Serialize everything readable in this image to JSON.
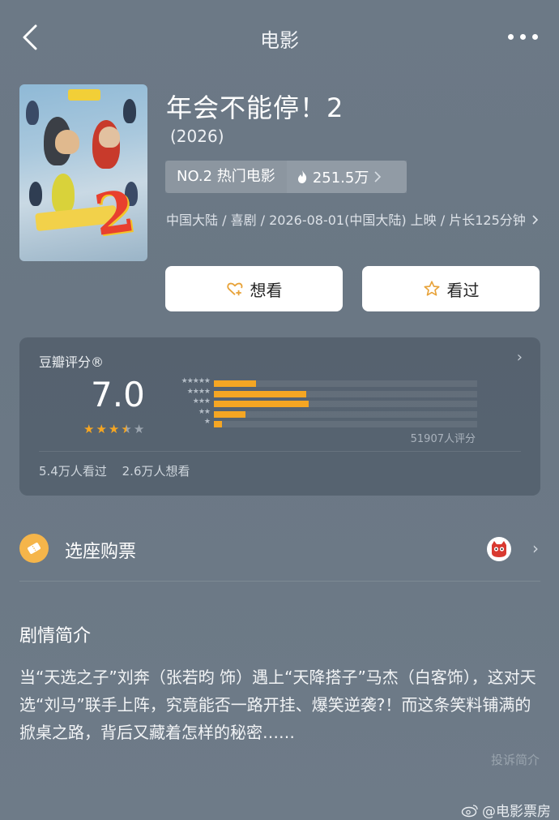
{
  "nav": {
    "title": "电影"
  },
  "movie": {
    "title": "年会不能停！2",
    "year": "(2026)",
    "rank": "NO.2 热门电影",
    "heat": "251.5万",
    "meta": "中国大陆 / 喜剧 / 2026-08-01(中国大陆) 上映 / 片长125分钟"
  },
  "buttons": {
    "want": "想看",
    "seen": "看过"
  },
  "rating": {
    "title": "豆瓣评分®",
    "score": "7.0",
    "stars_value": 3.5,
    "distribution": [
      {
        "label": "★★★★★",
        "percent": 16
      },
      {
        "label": "★★★★",
        "percent": 35
      },
      {
        "label": "★★★",
        "percent": 36
      },
      {
        "label": "★★",
        "percent": 12
      },
      {
        "label": "★",
        "percent": 3
      }
    ],
    "count": "51907人评分",
    "seen": "5.4万人看过",
    "want": "2.6万人想看"
  },
  "ticket": {
    "label": "选座购票"
  },
  "intro": {
    "title": "剧情简介",
    "text": "当“天选之子”刘奔（张若昀 饰）遇上“天降搭子”马杰（白客饰），这对天选“刘马”联手上阵，究竟能否一路开挂、爆笑逆袭?！而这条笑料铺满的掀桌之路，背后又藏着怎样的秘密……",
    "report": "投诉简介"
  },
  "watermark": "@电影票房",
  "colors": {
    "accent": "#f5a623",
    "background": "#6c7986",
    "ticket_icon": "#f5b54a"
  },
  "icons": {
    "back": "back-arrow-icon",
    "more": "more-icon",
    "heat": "fire-icon",
    "want": "heart-plus-icon",
    "seen": "star-outline-icon",
    "ticket": "ticket-icon",
    "partner": "maoyan-cat-icon",
    "weibo": "weibo-icon"
  }
}
